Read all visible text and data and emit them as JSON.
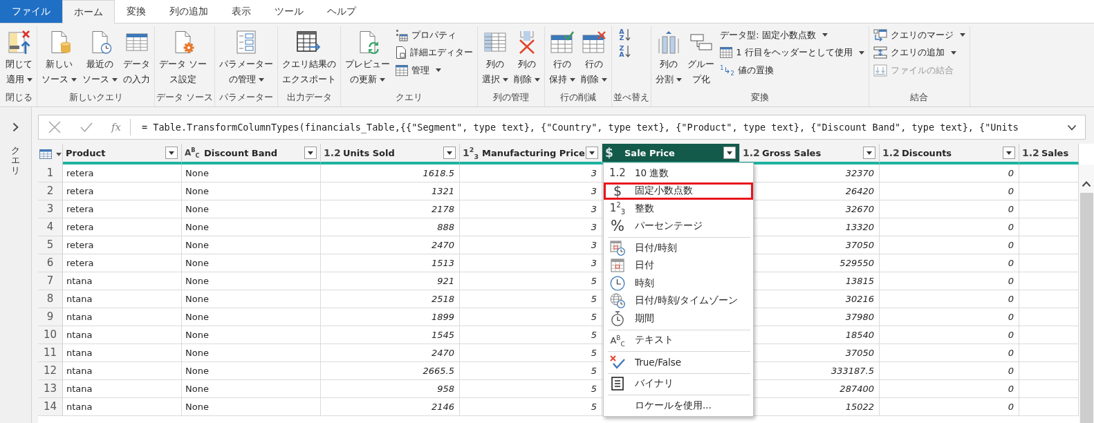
{
  "tabs": [
    {
      "label": "ファイル",
      "kind": "file",
      "selected": false
    },
    {
      "label": "ホーム",
      "kind": "tab",
      "selected": true
    },
    {
      "label": "変換",
      "kind": "tab",
      "selected": false
    },
    {
      "label": "列の追加",
      "kind": "tab",
      "selected": false
    },
    {
      "label": "表示",
      "kind": "tab",
      "selected": false
    },
    {
      "label": "ツール",
      "kind": "tab",
      "selected": false
    },
    {
      "label": "ヘルプ",
      "kind": "tab",
      "selected": false
    }
  ],
  "ribbon": {
    "groups": [
      {
        "label": "閉じる",
        "buttons": [
          {
            "kind": "large",
            "lines": [
              "閉じて",
              "適用"
            ],
            "dropdown": true,
            "disabled": false
          }
        ]
      },
      {
        "label": "新しいクエリ",
        "buttons": [
          {
            "kind": "large",
            "lines": [
              "新しい",
              "ソース"
            ],
            "dropdown": true,
            "disabled": false
          },
          {
            "kind": "large",
            "lines": [
              "最近の",
              "ソース"
            ],
            "dropdown": true,
            "disabled": false
          },
          {
            "kind": "large",
            "lines": [
              "データ",
              "の入力"
            ],
            "dropdown": false,
            "disabled": false
          }
        ]
      },
      {
        "label": "データ ソース",
        "buttons": [
          {
            "kind": "large",
            "lines": [
              "データ ソー",
              "ス設定"
            ],
            "dropdown": false,
            "disabled": false
          }
        ]
      },
      {
        "label": "パラメーター",
        "buttons": [
          {
            "kind": "large",
            "lines": [
              "パラメーター",
              "の管理"
            ],
            "dropdown": true,
            "disabled": false
          }
        ]
      },
      {
        "label": "出力データ",
        "buttons": [
          {
            "kind": "large",
            "lines": [
              "クエリ結果の",
              "エクスポート"
            ],
            "dropdown": false,
            "disabled": false
          }
        ]
      },
      {
        "label": "クエリ",
        "buttons": [
          {
            "kind": "large",
            "lines": [
              "プレビュー",
              "の更新"
            ],
            "dropdown": true,
            "disabled": false
          },
          {
            "kind": "small",
            "label": "プロパティ",
            "dropdown": false,
            "disabled": false
          },
          {
            "kind": "small",
            "label": "詳細エディター",
            "dropdown": false,
            "disabled": false
          },
          {
            "kind": "small",
            "label": "管理",
            "dropdown": true,
            "disabled": false
          }
        ]
      },
      {
        "label": "列の管理",
        "buttons": [
          {
            "kind": "large",
            "lines": [
              "列の",
              "選択"
            ],
            "dropdown": true,
            "disabled": false
          },
          {
            "kind": "large",
            "lines": [
              "列の",
              "削除"
            ],
            "dropdown": true,
            "disabled": false
          }
        ]
      },
      {
        "label": "行の削減",
        "buttons": [
          {
            "kind": "large",
            "lines": [
              "行の",
              "保持"
            ],
            "dropdown": true,
            "disabled": false
          },
          {
            "kind": "large",
            "lines": [
              "行の",
              "削除"
            ],
            "dropdown": true,
            "disabled": false
          }
        ]
      },
      {
        "label": "並べ替え",
        "buttons": [
          {
            "kind": "sort",
            "letters": [
              "A",
              "Z"
            ],
            "dropdown": false,
            "disabled": false
          },
          {
            "kind": "sort",
            "letters": [
              "Z",
              "A"
            ],
            "dropdown": false,
            "disabled": false
          }
        ]
      },
      {
        "label": "変換",
        "buttons": [
          {
            "kind": "large",
            "lines": [
              "列の",
              "分割"
            ],
            "dropdown": true,
            "disabled": false
          },
          {
            "kind": "large",
            "lines": [
              "グルー",
              "プ化"
            ],
            "dropdown": false,
            "disabled": false
          },
          {
            "kind": "small",
            "label": "データ型: 固定小数点数",
            "dropdown": true,
            "disabled": false
          },
          {
            "kind": "small",
            "label": "1 行目をヘッダーとして使用",
            "dropdown": true,
            "disabled": false
          },
          {
            "kind": "small",
            "label": "値の置換",
            "glyph": "$^{1}$↳$_{2}$",
            "dropdown": false,
            "disabled": false
          }
        ]
      },
      {
        "label": "結合",
        "buttons": [
          {
            "kind": "small",
            "label": "クエリのマージ",
            "dropdown": true,
            "disabled": false
          },
          {
            "kind": "small",
            "label": "クエリの追加",
            "dropdown": true,
            "disabled": false
          },
          {
            "kind": "small",
            "label": "ファイルの結合",
            "dropdown": false,
            "disabled": true
          }
        ]
      }
    ]
  },
  "query_pane": {
    "title": "クエリ"
  },
  "formula_bar": {
    "fx": "fx",
    "formula": "= Table.TransformColumnTypes(financials_Table,{{\"Segment\", type text}, {\"Country\", type text}, {\"Product\", type text}, {\"Discount Band\", type text}, {\"Units"
  },
  "table": {
    "columns": [
      {
        "label": "Product",
        "filter": true,
        "selected": false
      },
      {
        "label": "Discount Band",
        "kind": "text",
        "glyph": "A$^{B}$$_{C}$",
        "filter": true,
        "selected": false
      },
      {
        "label": "Units Sold",
        "kind": "decimal",
        "glyph": "1.2",
        "filter": true,
        "selected": false
      },
      {
        "label": "Manufacturing Price",
        "kind": "whole",
        "glyph": "1$^{2}$$_{3}$",
        "filter": true,
        "selected": false
      },
      {
        "label": "Sale Price",
        "kind": "currency",
        "glyph": "$",
        "filter": true,
        "selected": true
      },
      {
        "label": "Gross Sales",
        "kind": "decimal",
        "glyph": "1.2",
        "filter": true,
        "selected": false
      },
      {
        "label": "Discounts",
        "kind": "decimal",
        "glyph": "1.2",
        "filter": true,
        "selected": false
      },
      {
        "label": "Sales",
        "kind": "decimal",
        "glyph": "1.2",
        "filter": false,
        "selected": false
      }
    ],
    "rows": [
      {
        "number": "1",
        "product": "retera",
        "discount_band": "None",
        "units_sold": "1618.5",
        "manufacturing_price": "3",
        "gross_sales": "32370",
        "discounts": "0"
      },
      {
        "number": "2",
        "product": "retera",
        "discount_band": "None",
        "units_sold": "1321",
        "manufacturing_price": "3",
        "gross_sales": "26420",
        "discounts": "0"
      },
      {
        "number": "3",
        "product": "retera",
        "discount_band": "None",
        "units_sold": "2178",
        "manufacturing_price": "3",
        "gross_sales": "32670",
        "discounts": "0"
      },
      {
        "number": "4",
        "product": "retera",
        "discount_band": "None",
        "units_sold": "888",
        "manufacturing_price": "3",
        "gross_sales": "13320",
        "discounts": "0"
      },
      {
        "number": "5",
        "product": "retera",
        "discount_band": "None",
        "units_sold": "2470",
        "manufacturing_price": "3",
        "gross_sales": "37050",
        "discounts": "0"
      },
      {
        "number": "6",
        "product": "retera",
        "discount_band": "None",
        "units_sold": "1513",
        "manufacturing_price": "3",
        "gross_sales": "529550",
        "discounts": "0"
      },
      {
        "number": "7",
        "product": "ntana",
        "discount_band": "None",
        "units_sold": "921",
        "manufacturing_price": "5",
        "gross_sales": "13815",
        "discounts": "0"
      },
      {
        "number": "8",
        "product": "ntana",
        "discount_band": "None",
        "units_sold": "2518",
        "manufacturing_price": "5",
        "gross_sales": "30216",
        "discounts": "0"
      },
      {
        "number": "9",
        "product": "ntana",
        "discount_band": "None",
        "units_sold": "1899",
        "manufacturing_price": "5",
        "gross_sales": "37980",
        "discounts": "0"
      },
      {
        "number": "10",
        "product": "ntana",
        "discount_band": "None",
        "units_sold": "1545",
        "manufacturing_price": "5",
        "gross_sales": "18540",
        "discounts": "0"
      },
      {
        "number": "11",
        "product": "ntana",
        "discount_band": "None",
        "units_sold": "2470",
        "manufacturing_price": "5",
        "gross_sales": "37050",
        "discounts": "0"
      },
      {
        "number": "12",
        "product": "ntana",
        "discount_band": "None",
        "units_sold": "2665.5",
        "manufacturing_price": "5",
        "gross_sales": "333187.5",
        "discounts": "0"
      },
      {
        "number": "13",
        "product": "ntana",
        "discount_band": "None",
        "units_sold": "958",
        "manufacturing_price": "5",
        "gross_sales": "287400",
        "discounts": "0"
      },
      {
        "number": "14",
        "product": "ntana",
        "discount_band": "None",
        "units_sold": "2146",
        "manufacturing_price": "5",
        "gross_sales": "15022",
        "discounts": "0"
      }
    ]
  },
  "type_menu": {
    "sections": [
      [
        {
          "kind": "decimal",
          "glyph": "1.2",
          "label": "10 進数",
          "selected": false
        },
        {
          "kind": "currency",
          "glyph": "$",
          "label": "固定小数点数",
          "selected": true
        },
        {
          "kind": "whole",
          "glyph": "1$^{2}$$_{3}$",
          "label": "整数",
          "selected": false
        },
        {
          "kind": "percent",
          "glyph": "%",
          "label": "パーセンテージ",
          "selected": false
        }
      ],
      [
        {
          "kind": "datetime",
          "label": "日付/時刻",
          "selected": false
        },
        {
          "kind": "date",
          "label": "日付",
          "selected": false
        },
        {
          "kind": "time",
          "label": "時刻",
          "selected": false
        },
        {
          "kind": "datetimezone",
          "label": "日付/時刻/タイムゾーン",
          "selected": false
        },
        {
          "kind": "duration",
          "label": "期間",
          "selected": false
        }
      ],
      [
        {
          "kind": "text",
          "glyph": "A$^{B}$$_{C}$",
          "label": "テキスト",
          "selected": false
        }
      ],
      [
        {
          "kind": "logical",
          "label": "True/False",
          "selected": false
        }
      ],
      [
        {
          "kind": "binary",
          "label": "バイナリ",
          "selected": false
        }
      ],
      [
        {
          "kind": "locale",
          "label": "ロケールを使用...",
          "selected": false
        }
      ]
    ]
  }
}
